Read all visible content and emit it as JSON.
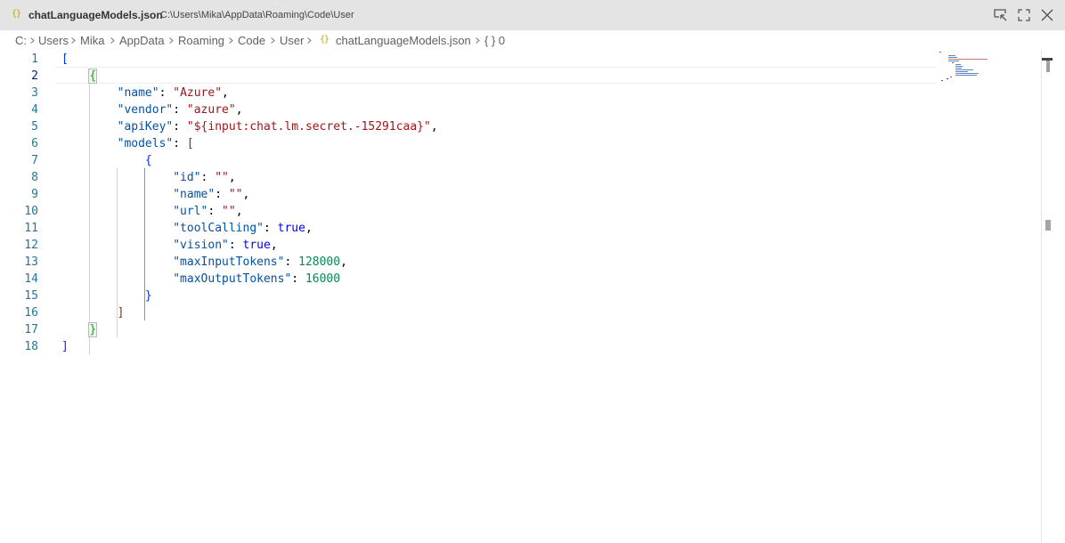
{
  "titlebar": {
    "file_icon": "{}",
    "file_name": "chatLanguageModels.json",
    "file_path": "C:\\Users\\Mika\\AppData\\Roaming\\Code\\User",
    "buttons": [
      "focus-editor-icon",
      "fullscreen-icon",
      "close-icon"
    ]
  },
  "breadcrumb": {
    "segments": [
      "C:",
      "Users",
      "Mika",
      "AppData",
      "Roaming",
      "Code",
      "User"
    ],
    "file_icon": "{}",
    "file": "chatLanguageModels.json",
    "symbol": "{ } 0"
  },
  "editor": {
    "active_line": 2,
    "line_numbers": [
      "1",
      "2",
      "3",
      "4",
      "5",
      "6",
      "7",
      "8",
      "9",
      "10",
      "11",
      "12",
      "13",
      "14",
      "15",
      "16",
      "17",
      "18"
    ],
    "lines": [
      [
        {
          "t": "[",
          "c": "b1"
        }
      ],
      [
        {
          "t": "    "
        },
        {
          "t": "{",
          "c": "b2 match"
        }
      ],
      [
        {
          "t": "        "
        },
        {
          "t": "\"name\"",
          "c": "k"
        },
        {
          "t": ": "
        },
        {
          "t": "\"Azure\"",
          "c": "s"
        },
        {
          "t": ","
        }
      ],
      [
        {
          "t": "        "
        },
        {
          "t": "\"vendor\"",
          "c": "k"
        },
        {
          "t": ": "
        },
        {
          "t": "\"azure\"",
          "c": "s"
        },
        {
          "t": ","
        }
      ],
      [
        {
          "t": "        "
        },
        {
          "t": "\"apiKey\"",
          "c": "k"
        },
        {
          "t": ": "
        },
        {
          "t": "\"${input:chat.lm.secret.-15291caa}\"",
          "c": "s"
        },
        {
          "t": ","
        }
      ],
      [
        {
          "t": "        "
        },
        {
          "t": "\"models\"",
          "c": "k"
        },
        {
          "t": ": "
        },
        {
          "t": "[",
          "c": "b3"
        }
      ],
      [
        {
          "t": "            "
        },
        {
          "t": "{",
          "c": "b1"
        }
      ],
      [
        {
          "t": "                "
        },
        {
          "t": "\"id\"",
          "c": "k"
        },
        {
          "t": ": "
        },
        {
          "t": "\"\"",
          "c": "s"
        },
        {
          "t": ","
        }
      ],
      [
        {
          "t": "                "
        },
        {
          "t": "\"name\"",
          "c": "k"
        },
        {
          "t": ": "
        },
        {
          "t": "\"\"",
          "c": "s"
        },
        {
          "t": ","
        }
      ],
      [
        {
          "t": "                "
        },
        {
          "t": "\"url\"",
          "c": "k"
        },
        {
          "t": ": "
        },
        {
          "t": "\"\"",
          "c": "s"
        },
        {
          "t": ","
        }
      ],
      [
        {
          "t": "                "
        },
        {
          "t": "\"toolCalling\"",
          "c": "k"
        },
        {
          "t": ": "
        },
        {
          "t": "true",
          "c": "kw"
        },
        {
          "t": ","
        }
      ],
      [
        {
          "t": "                "
        },
        {
          "t": "\"vision\"",
          "c": "k"
        },
        {
          "t": ": "
        },
        {
          "t": "true",
          "c": "kw"
        },
        {
          "t": ","
        }
      ],
      [
        {
          "t": "                "
        },
        {
          "t": "\"maxInputTokens\"",
          "c": "k"
        },
        {
          "t": ": "
        },
        {
          "t": "128000",
          "c": "n"
        },
        {
          "t": ","
        }
      ],
      [
        {
          "t": "                "
        },
        {
          "t": "\"maxOutputTokens\"",
          "c": "k"
        },
        {
          "t": ": "
        },
        {
          "t": "16000",
          "c": "n"
        }
      ],
      [
        {
          "t": "            "
        },
        {
          "t": "}",
          "c": "b1"
        }
      ],
      [
        {
          "t": "        "
        },
        {
          "t": "]",
          "c": "b3"
        }
      ],
      [
        {
          "t": "    "
        },
        {
          "t": "}",
          "c": "b2 match"
        }
      ],
      [
        {
          "t": "]",
          "c": "b1"
        }
      ]
    ]
  },
  "colors": {
    "property_key": "#0451a5",
    "string": "#a31515",
    "number": "#098658",
    "keyword": "#0000ff",
    "line_number": "#237893",
    "titlebar_bg": "#e4e4e4"
  }
}
